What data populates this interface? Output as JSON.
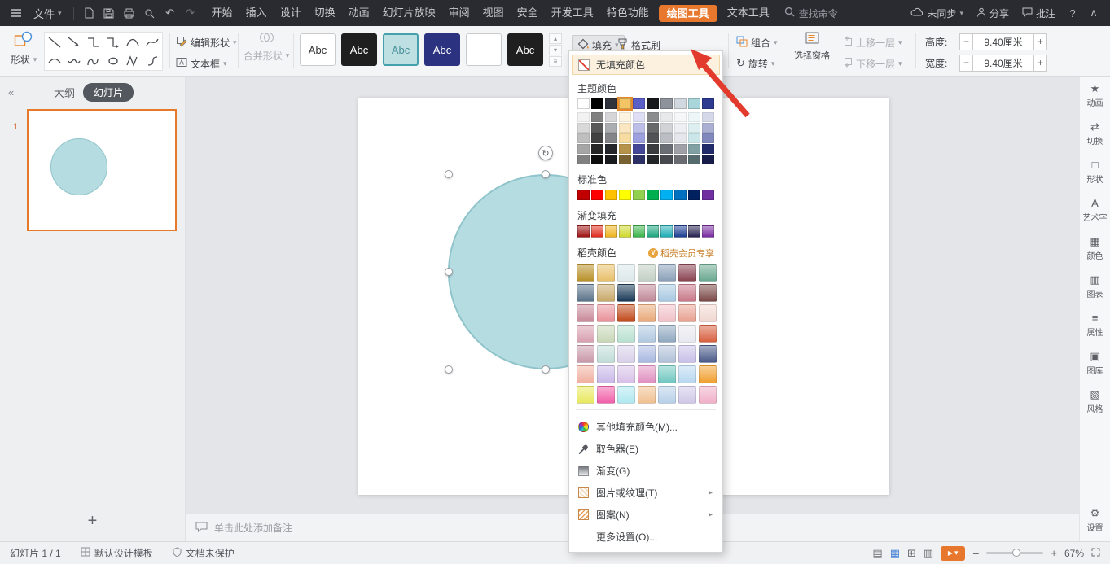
{
  "titlebar": {
    "file_label": "文件",
    "menus": [
      {
        "label": "开始"
      },
      {
        "label": "插入"
      },
      {
        "label": "设计"
      },
      {
        "label": "切换"
      },
      {
        "label": "动画"
      },
      {
        "label": "幻灯片放映"
      },
      {
        "label": "审阅"
      },
      {
        "label": "视图"
      },
      {
        "label": "安全"
      },
      {
        "label": "开发工具"
      },
      {
        "label": "特色功能"
      },
      {
        "label": "绘图工具",
        "active": true
      },
      {
        "label": "文本工具"
      }
    ],
    "search_label": "查找命令",
    "sync_label": "未同步",
    "share_label": "分享",
    "comment_label": "批注",
    "help_label": "?"
  },
  "ribbon": {
    "shapes_label": "形状",
    "edit_shape_label": "编辑形状",
    "textbox_label": "文本框",
    "merge_shapes_label": "合并形状",
    "style_presets": [
      {
        "label": "Abc",
        "bg": "#ffffff",
        "fg": "#333333",
        "border": "#c9cbcd"
      },
      {
        "label": "Abc",
        "bg": "#1f1f1f",
        "fg": "#ffffff",
        "border": "#1f1f1f"
      },
      {
        "label": "Abc",
        "bg": "#bfe0e3",
        "fg": "#47909a",
        "border": "#44a0aa",
        "selected": true
      },
      {
        "label": "Abc",
        "bg": "#2b3380",
        "fg": "#ffffff",
        "border": "#2b3380"
      },
      {
        "label": "",
        "bg": "#ffffff",
        "fg": "#333333",
        "border": "#c9cbcd"
      },
      {
        "label": "Abc",
        "bg": "#1f1f1f",
        "fg": "#ffffff",
        "border": "#1f1f1f"
      }
    ],
    "fill_label": "填充",
    "format_painter_label": "格式刷",
    "group_label": "组合",
    "rotate_label": "旋转",
    "selection_pane_label": "选择窗格",
    "bring_forward_label": "上移一层",
    "send_backward_label": "下移一层",
    "height_label": "高度:",
    "height_value": "9.40厘米",
    "width_label": "宽度:",
    "width_value": "9.40厘米"
  },
  "left_panel": {
    "collapse_icon": "«",
    "outline_tab": "大纲",
    "slides_tab": "幻灯片",
    "slide_number": "1",
    "add_slide_label": "+"
  },
  "fill_menu": {
    "no_fill_label": "无填充颜色",
    "theme_section_label": "主题颜色",
    "theme_colors": [
      "#ffffff",
      "#000000",
      "#30333b",
      "#f2c463",
      "#5a60c8",
      "#17181c",
      "#8d929b",
      "#d2d8df",
      "#a9d6da",
      "#2d3a8f"
    ],
    "selected_theme_index": 3,
    "standard_section_label": "标准色",
    "standard_colors": [
      "#c00000",
      "#ff0000",
      "#ffc000",
      "#ffff00",
      "#92d050",
      "#00b050",
      "#00b0f0",
      "#0070c0",
      "#002060",
      "#7030a0"
    ],
    "gradient_section_label": "渐变填充",
    "gradient_colors": [
      "#9e1313",
      "#e02b1d",
      "#efb31c",
      "#cfd92e",
      "#3bb44a",
      "#1ba57e",
      "#1fadb5",
      "#1c3f94",
      "#26224f",
      "#7a2da0"
    ],
    "docer_section_label": "稻壳颜色",
    "docer_badge_label": "稻壳会员专享",
    "docer_rows": [
      [
        "#b8912a",
        "#e8c06a",
        "#dce8ea",
        "#c2cfc4",
        "#8aa0b8",
        "#8a4452",
        "#6aa890"
      ],
      [
        "#5a7288",
        "#c8a86a",
        "#1a3a58",
        "#c08898",
        "#a8c8e0",
        "#c87888",
        "#7a4a48"
      ],
      [
        "#c88898",
        "#e89098",
        "#c04818",
        "#e8a878",
        "#f0c0c8",
        "#e8a090",
        "#f0d8d0"
      ],
      [
        "#d8a0b0",
        "#c8d8b8",
        "#b8e0d0",
        "#b0c8e0",
        "#90a8c0",
        "#e8e8f0",
        "#d86040"
      ],
      [
        "#c898a8",
        "#c0dcd8",
        "#d8d0e8",
        "#a8b8e0",
        "#b0c0d8",
        "#c8c0e8",
        "#4a5a88"
      ],
      [
        "#f0b0a0",
        "#c8b8e8",
        "#d8c0e8",
        "#e090c0",
        "#70c8c0",
        "#b8d8f0",
        "#f0a030"
      ],
      [
        "#e8e860",
        "#f060a8",
        "#b0e8f0",
        "#f0c090",
        "#b8d0e8",
        "#d0c8e8",
        "#f0b0c8"
      ]
    ],
    "items": [
      {
        "label": "其他填充颜色(M)...",
        "icon": "color-wheel-icon"
      },
      {
        "label": "取色器(E)",
        "icon": "eyedropper-icon"
      },
      {
        "label": "渐变(G)",
        "icon": "gradient-icon"
      },
      {
        "label": "图片或纹理(T)",
        "icon": "picture-icon",
        "submenu": true
      },
      {
        "label": "图案(N)",
        "icon": "pattern-icon",
        "submenu": true
      },
      {
        "label": "更多设置(O)...",
        "icon": "none"
      }
    ]
  },
  "right_rail": {
    "items": [
      {
        "label": "动画",
        "icon": "animation-icon",
        "glyph": "★"
      },
      {
        "label": "切换",
        "icon": "transition-icon",
        "glyph": "⇄"
      },
      {
        "label": "形状",
        "icon": "shape-icon",
        "glyph": "□"
      },
      {
        "label": "艺术字",
        "icon": "wordart-icon",
        "glyph": "A"
      },
      {
        "label": "颜色",
        "icon": "color-icon",
        "glyph": "▦"
      },
      {
        "label": "图表",
        "icon": "chart-icon",
        "glyph": "▥"
      },
      {
        "label": "属性",
        "icon": "properties-icon",
        "glyph": "≡"
      },
      {
        "label": "图库",
        "icon": "gallery-icon",
        "glyph": "▣"
      },
      {
        "label": "风格",
        "icon": "style-icon",
        "glyph": "▧"
      }
    ],
    "bottom_item": {
      "label": "设置",
      "icon": "gear-icon",
      "glyph": "⚙"
    }
  },
  "notes": {
    "placeholder": "单击此处添加备注"
  },
  "statusbar": {
    "slide_info": "幻灯片 1 / 1",
    "template_label": "默认设计模板",
    "protect_label": "文档未保护",
    "zoom_percent": "67%"
  },
  "colors": {
    "accent_orange": "#e8782e",
    "shape_fill": "#b5dce1",
    "shape_stroke": "#8fc4cb",
    "titlebar_bg": "#292b31"
  }
}
